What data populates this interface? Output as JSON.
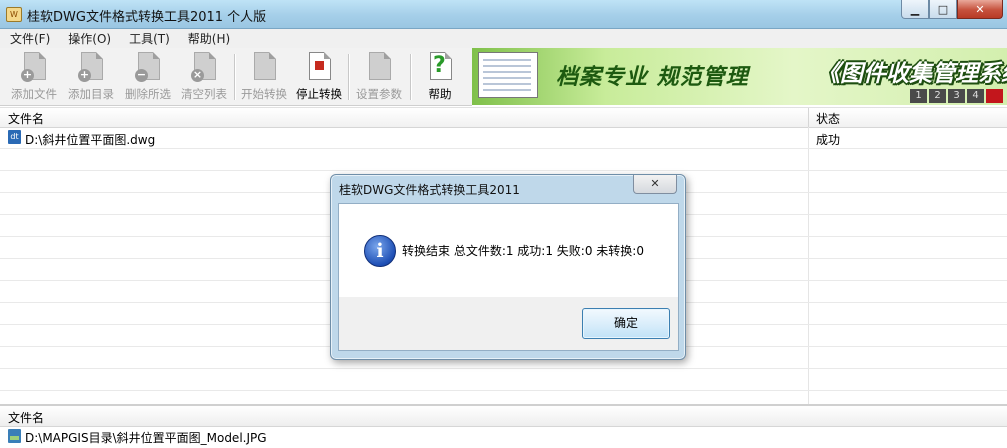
{
  "window": {
    "title": "桂软DWG文件格式转换工具2011 个人版",
    "app_icon_text": "W",
    "minimize": "▁",
    "maximize": "□",
    "close": "✕"
  },
  "menu": [
    "文件(F)",
    "操作(O)",
    "工具(T)",
    "帮助(H)"
  ],
  "toolbar": {
    "add_file": "添加文件",
    "add_dir": "添加目录",
    "delete_selected": "删除所选",
    "clear_list": "清空列表",
    "start_convert": "开始转换",
    "stop_convert": "停止转换",
    "settings": "设置参数",
    "help": "帮助"
  },
  "banner": {
    "slogan": "档案专业 规范管理",
    "product": "《图件收集管理系统》",
    "pages": [
      "1",
      "2",
      "3",
      "4"
    ]
  },
  "file_list": {
    "col_name": "文件名",
    "col_status": "状态",
    "rows": [
      {
        "name": "D:\\斜井位置平面图.dwg",
        "status": "成功"
      }
    ]
  },
  "output_list": {
    "col_name": "文件名",
    "rows": [
      {
        "name": "D:\\MAPGIS目录\\斜井位置平面图_Model.JPG"
      }
    ]
  },
  "dialog": {
    "title": "桂软DWG文件格式转换工具2011",
    "close": "✕",
    "message": "转换结束 总文件数:1 成功:1 失败:0 未转换:0",
    "ok": "确定"
  }
}
